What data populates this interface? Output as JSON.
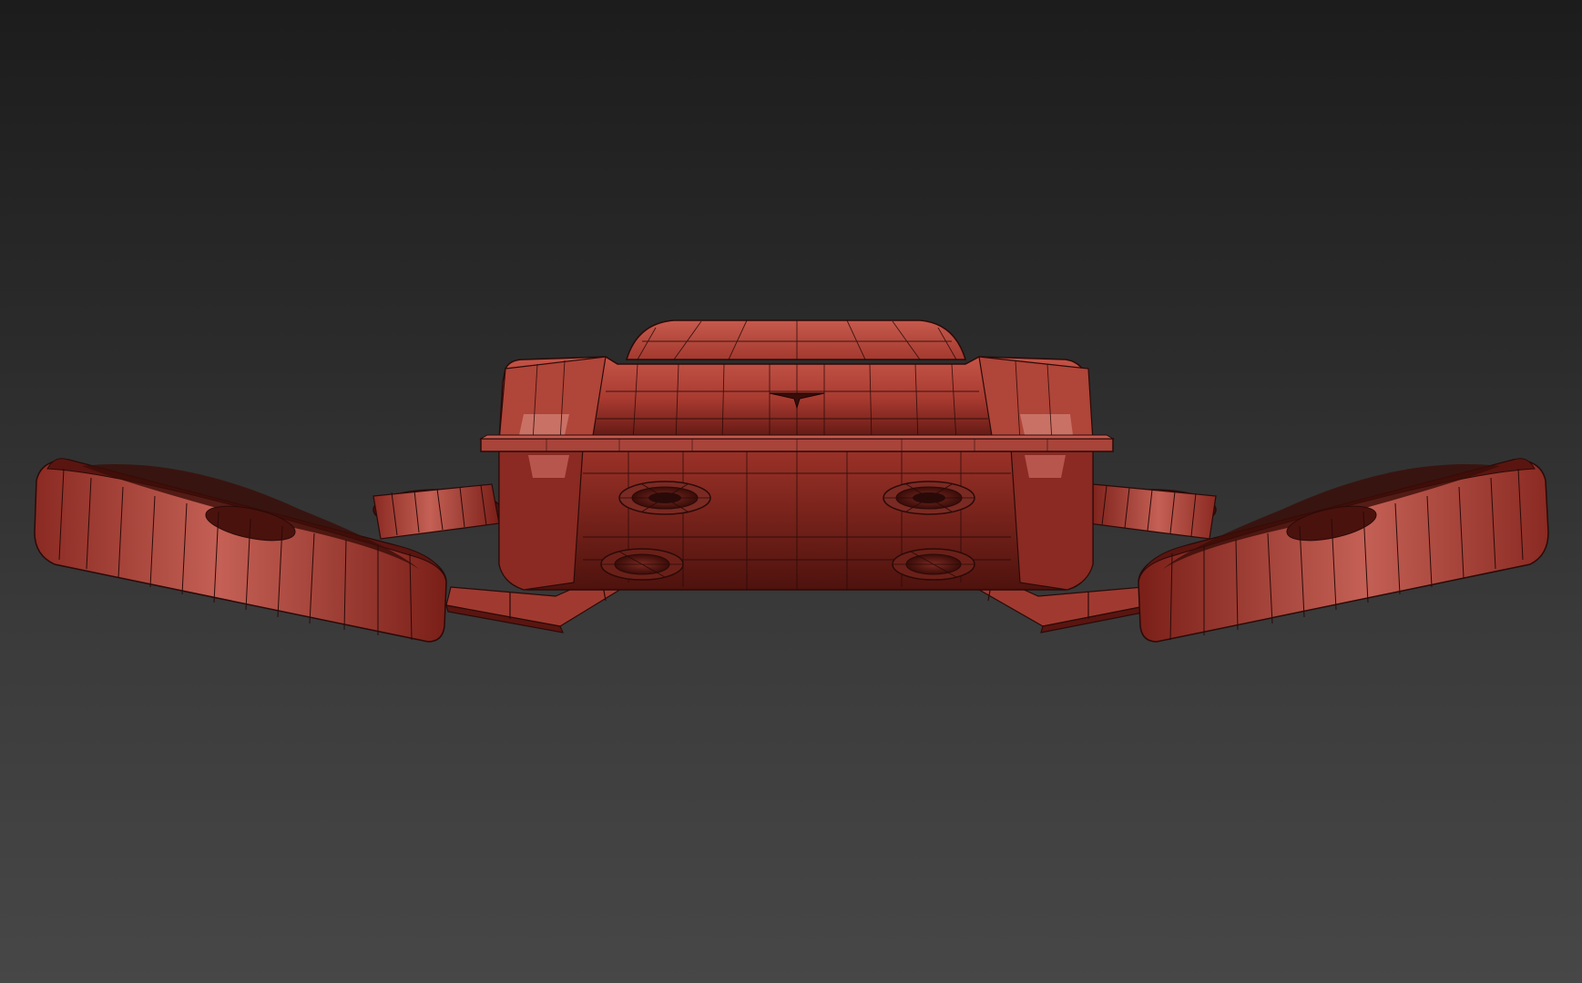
{
  "viewport": {
    "background_top": "#1c1c1c",
    "background_bottom": "#474747"
  },
  "model": {
    "subject": "flying-car-drone",
    "shading": "wireframe-on-shaded",
    "surface_color": "#b8453a",
    "shadow_color": "#5a1510",
    "highlight_color": "#d97a70",
    "wire_color": "#2a0a08"
  }
}
